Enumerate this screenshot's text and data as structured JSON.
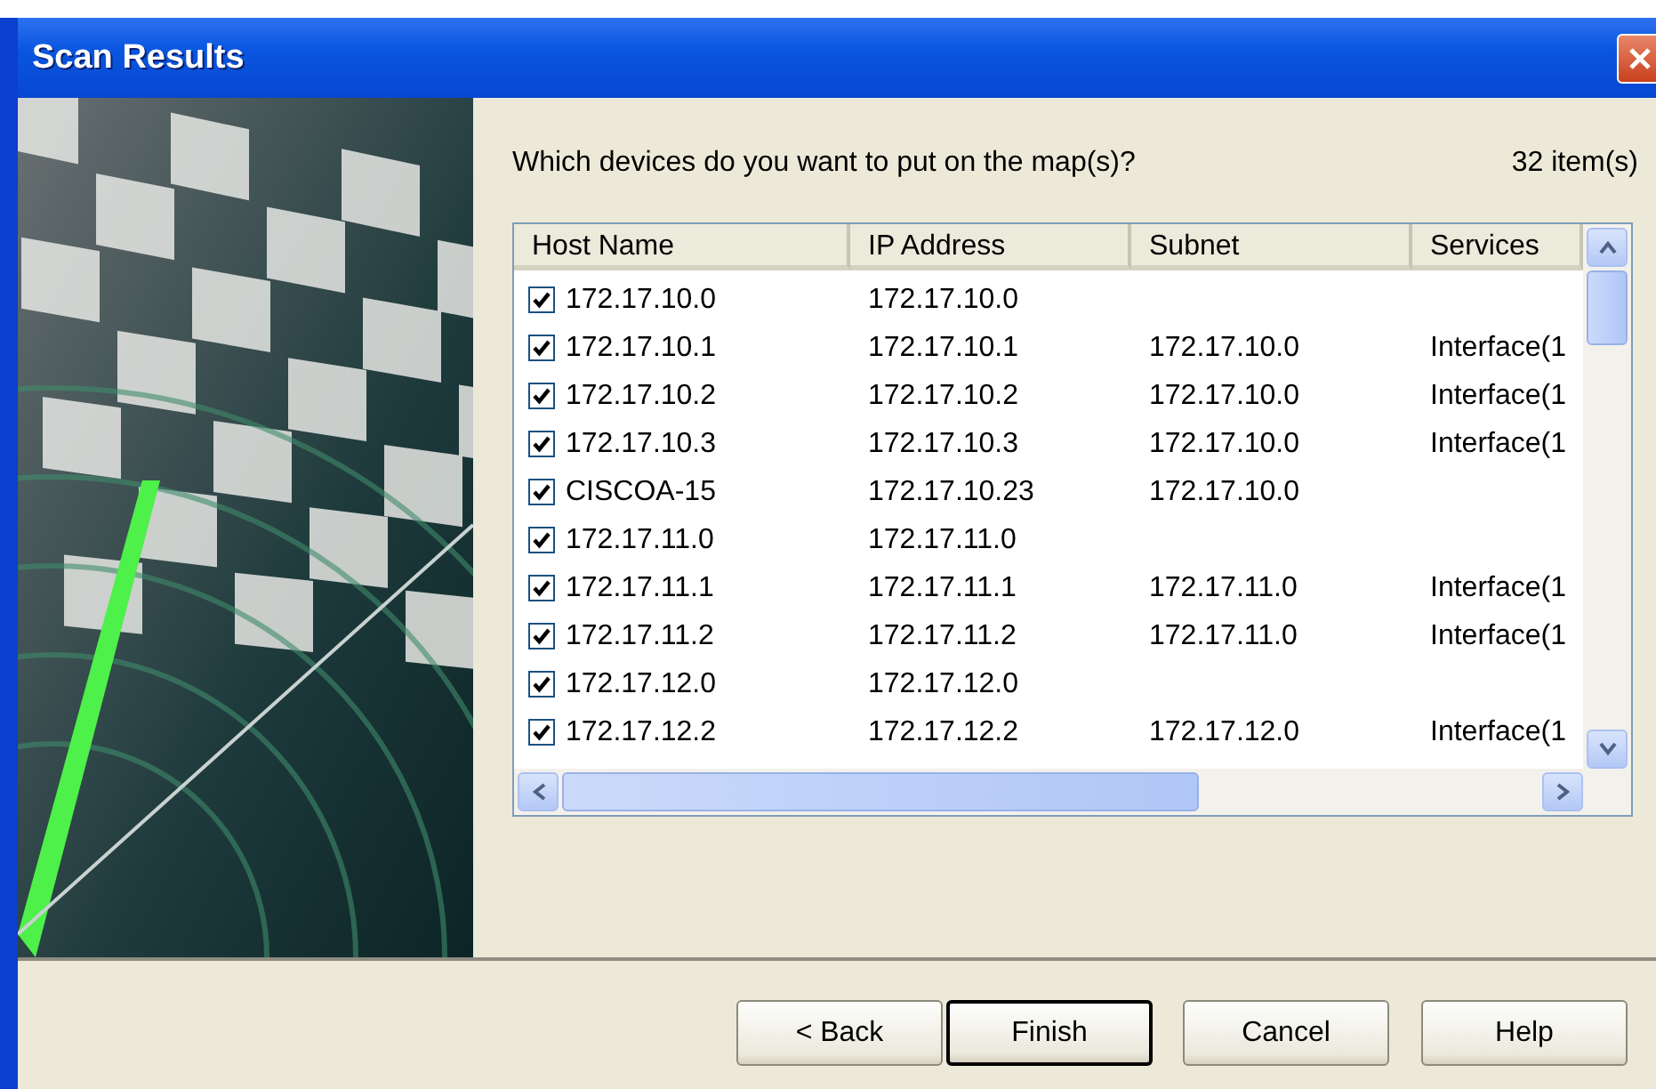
{
  "window": {
    "title": "Scan Results"
  },
  "prompt": "Which devices do you want to put on the map(s)?",
  "item_count": "32 item(s)",
  "table": {
    "columns": [
      "Host Name",
      "IP Address",
      "Subnet",
      "Services"
    ],
    "rows": [
      {
        "checked": true,
        "cells": [
          "172.17.10.0",
          "172.17.10.0",
          "",
          ""
        ]
      },
      {
        "checked": true,
        "cells": [
          "172.17.10.1",
          "172.17.10.1",
          "172.17.10.0",
          "Interface(1"
        ]
      },
      {
        "checked": true,
        "cells": [
          "172.17.10.2",
          "172.17.10.2",
          "172.17.10.0",
          "Interface(1"
        ]
      },
      {
        "checked": true,
        "cells": [
          "172.17.10.3",
          "172.17.10.3",
          "172.17.10.0",
          "Interface(1"
        ]
      },
      {
        "checked": true,
        "cells": [
          "CISCOA-15",
          "172.17.10.23",
          "172.17.10.0",
          ""
        ]
      },
      {
        "checked": true,
        "cells": [
          "172.17.11.0",
          "172.17.11.0",
          "",
          ""
        ]
      },
      {
        "checked": true,
        "cells": [
          "172.17.11.1",
          "172.17.11.1",
          "172.17.11.0",
          "Interface(1"
        ]
      },
      {
        "checked": true,
        "cells": [
          "172.17.11.2",
          "172.17.11.2",
          "172.17.11.0",
          "Interface(1"
        ]
      },
      {
        "checked": true,
        "cells": [
          "172.17.12.0",
          "172.17.12.0",
          "",
          ""
        ]
      },
      {
        "checked": true,
        "cells": [
          "172.17.12.2",
          "172.17.12.2",
          "172.17.12.0",
          "Interface(1"
        ]
      }
    ]
  },
  "buttons": [
    {
      "label": "< Back",
      "default": false
    },
    {
      "label": "Finish",
      "default": true
    },
    {
      "label": "Cancel",
      "default": false
    },
    {
      "label": "Help",
      "default": false
    }
  ]
}
